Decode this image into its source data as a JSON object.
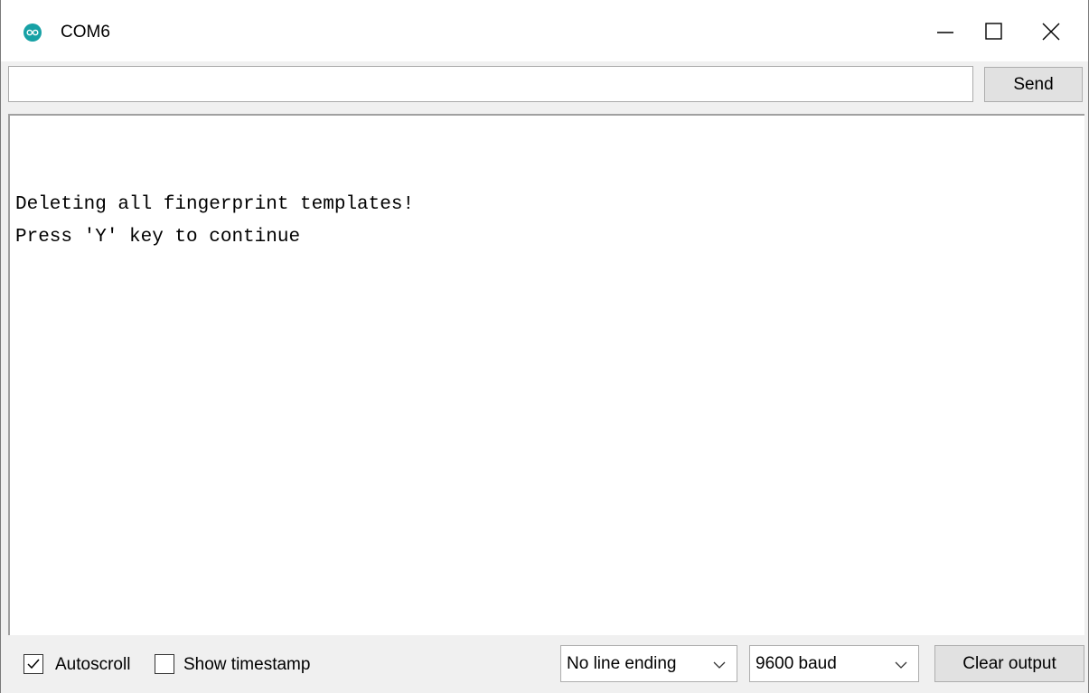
{
  "window": {
    "title": "COM6"
  },
  "controls": {
    "minimize_icon": "minimize-icon",
    "maximize_icon": "maximize-icon",
    "close_icon": "close-icon"
  },
  "send_bar": {
    "input_value": "",
    "send_label": "Send"
  },
  "output": {
    "lines": [
      "Deleting all fingerprint templates!",
      "Press 'Y' key to continue"
    ]
  },
  "footer": {
    "autoscroll": {
      "label": "Autoscroll",
      "checked": true
    },
    "timestamp": {
      "label": "Show timestamp",
      "checked": false
    },
    "line_ending": {
      "value": "No line ending"
    },
    "baud": {
      "value": "9600 baud"
    },
    "clear_label": "Clear output"
  },
  "colors": {
    "accent": "#17a1a5"
  }
}
